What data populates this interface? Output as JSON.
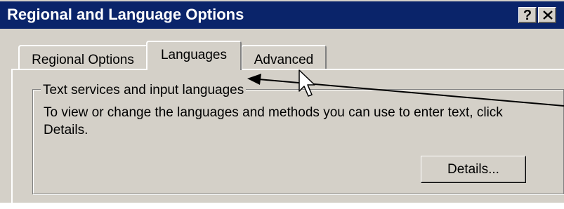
{
  "window": {
    "title": "Regional and Language Options",
    "help_label": "?",
    "accent": "#0a246a",
    "face": "#d4d0c8"
  },
  "tabs": [
    {
      "label": "Regional Options",
      "selected": false
    },
    {
      "label": "Languages",
      "selected": true
    },
    {
      "label": "Advanced",
      "selected": false
    }
  ],
  "group": {
    "label": "Text services and input languages",
    "description": "To view or change the languages and methods you can use to enter text, click Details."
  },
  "buttons": {
    "details": "Details..."
  }
}
